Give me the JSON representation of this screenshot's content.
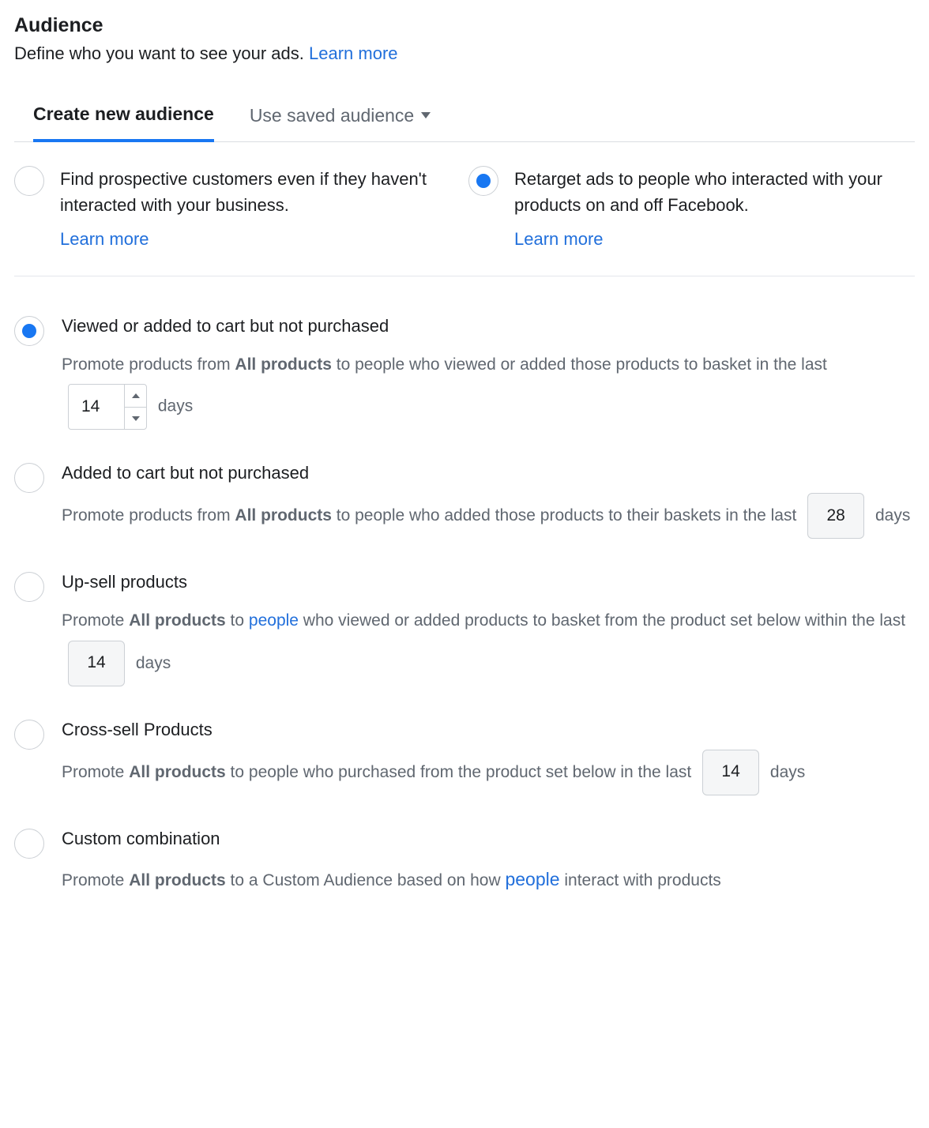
{
  "header": {
    "title": "Audience",
    "description": "Define who you want to see your ads. ",
    "learn_more": "Learn more"
  },
  "tabs": {
    "create": "Create new audience",
    "saved": "Use saved audience"
  },
  "audience_type": {
    "prospective": {
      "text": "Find prospective customers even if they haven't interacted with your business.",
      "learn_more": "Learn more"
    },
    "retarget": {
      "text": "Retarget ads to people who interacted with your products on and off Facebook.",
      "learn_more": "Learn more"
    }
  },
  "options": {
    "viewed_cart": {
      "title": "Viewed or added to cart but not purchased",
      "desc_pre": "Promote products from ",
      "desc_bold": "All products",
      "desc_mid": " to people who viewed or added those products to basket in the last ",
      "value": "14",
      "desc_post": " days"
    },
    "added_cart": {
      "title": "Added to cart but not purchased",
      "desc_pre": "Promote products from ",
      "desc_bold": "All products",
      "desc_mid": " to people who added those products to their baskets in the last ",
      "value": "28",
      "desc_post": " days"
    },
    "upsell": {
      "title": "Up-sell products",
      "desc_pre": "Promote ",
      "desc_bold": "All products",
      "desc_mid_a": " to ",
      "desc_link": "people",
      "desc_mid_b": " who viewed or added products to basket from the product set below within the last ",
      "value": "14",
      "desc_post": " days"
    },
    "crosssell": {
      "title": "Cross-sell Products",
      "desc_pre": "Promote ",
      "desc_bold": "All products",
      "desc_mid": " to people who purchased from the product set below in the last ",
      "value": "14",
      "desc_post": " days"
    },
    "custom": {
      "title": "Custom combination",
      "desc_pre": "Promote ",
      "desc_bold": "All products",
      "desc_mid_a": " to a Custom Audience based on how ",
      "desc_link": "people",
      "desc_mid_b": " interact with products"
    }
  }
}
